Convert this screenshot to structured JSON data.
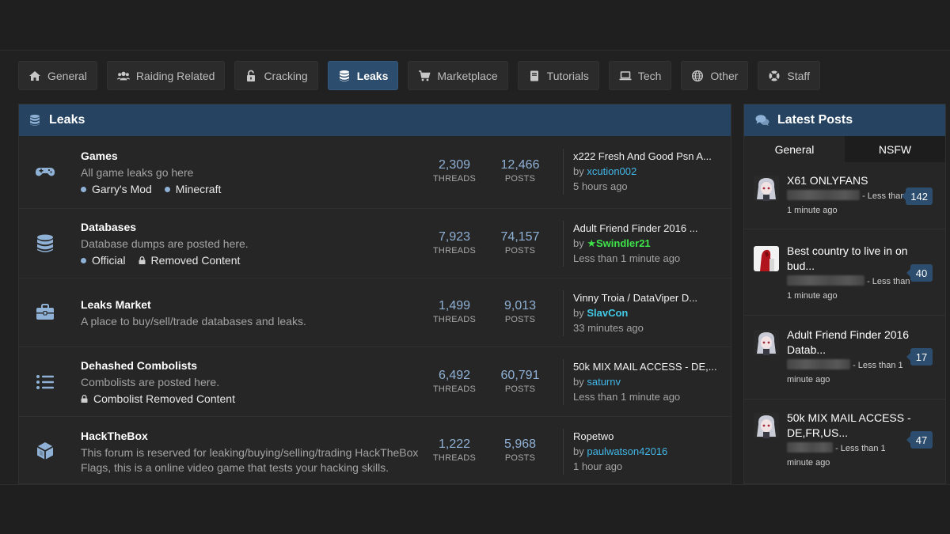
{
  "tabs": [
    {
      "label": "General",
      "icon": "home-icon"
    },
    {
      "label": "Raiding Related",
      "icon": "users-icon"
    },
    {
      "label": "Cracking",
      "icon": "unlock-icon"
    },
    {
      "label": "Leaks",
      "icon": "database-icon"
    },
    {
      "label": "Marketplace",
      "icon": "cart-icon"
    },
    {
      "label": "Tutorials",
      "icon": "book-icon"
    },
    {
      "label": "Tech",
      "icon": "laptop-icon"
    },
    {
      "label": "Other",
      "icon": "globe-icon"
    },
    {
      "label": "Staff",
      "icon": "lifering-icon"
    }
  ],
  "active_tab": "Leaks",
  "section": {
    "title": "Leaks",
    "forums": [
      {
        "icon": "gamepad-icon",
        "title": "Games",
        "desc": "All game leaks go here",
        "subs": [
          {
            "label": "Garry's Mod",
            "type": "dot"
          },
          {
            "label": "Minecraft",
            "type": "dot"
          }
        ],
        "threads": "2,309",
        "posts": "12,466",
        "threads_label": "THREADS",
        "posts_label": "POSTS",
        "last_title": "x222 Fresh And Good Psn A...",
        "by": "by",
        "last_user": "xcution002",
        "user_style": "normal",
        "last_time": "5 hours ago"
      },
      {
        "icon": "database-icon",
        "title": "Databases",
        "desc": "Database dumps are posted here.",
        "subs": [
          {
            "label": "Official",
            "type": "dot"
          },
          {
            "label": "Removed Content",
            "type": "lock"
          }
        ],
        "threads": "7,923",
        "posts": "74,157",
        "threads_label": "THREADS",
        "posts_label": "POSTS",
        "last_title": "Adult Friend Finder 2016 ...",
        "by": "by",
        "last_user": "Swindler21",
        "user_style": "green",
        "last_time": "Less than 1 minute ago"
      },
      {
        "icon": "briefcase-icon",
        "title": "Leaks Market",
        "desc": "A place to buy/sell/trade databases and leaks.",
        "subs": [],
        "threads": "1,499",
        "posts": "9,013",
        "threads_label": "THREADS",
        "posts_label": "POSTS",
        "last_title": "Vinny Troia / DataViper D...",
        "by": "by",
        "last_user": "SlavCon",
        "user_style": "cyan",
        "last_time": "33 minutes ago"
      },
      {
        "icon": "list-icon",
        "title": "Dehashed Combolists",
        "desc": "Combolists are posted here.",
        "subs": [
          {
            "label": "Combolist Removed Content",
            "type": "lock"
          }
        ],
        "threads": "6,492",
        "posts": "60,791",
        "threads_label": "THREADS",
        "posts_label": "POSTS",
        "last_title": "50k MIX MAIL ACCESS - DE,...",
        "by": "by",
        "last_user": "saturnv",
        "user_style": "normal",
        "last_time": "Less than 1 minute ago"
      },
      {
        "icon": "cube-icon",
        "title": "HackTheBox",
        "desc": "This forum is reserved for leaking/buying/selling/trading HackTheBox Flags, this is a online video game that tests your hacking skills.",
        "subs": [],
        "threads": "1,222",
        "posts": "5,968",
        "threads_label": "THREADS",
        "posts_label": "POSTS",
        "last_title": "Ropetwo",
        "by": "by",
        "last_user": "paulwatson42016",
        "user_style": "normal",
        "last_time": "1 hour ago"
      }
    ]
  },
  "latest": {
    "title": "Latest Posts",
    "tabs": [
      "General",
      "NSFW"
    ],
    "posts": [
      {
        "title": "X61 ONLYFANS",
        "meta_mid": "- Less than",
        "meta_end": "1 minute ago",
        "count": "142",
        "avatar": "anime-avatar"
      },
      {
        "title": "Best country to live in on bud...",
        "meta_mid": "- Less than",
        "meta_end": "1 minute ago",
        "count": "40",
        "avatar": "red-avatar"
      },
      {
        "title": "Adult Friend Finder 2016 Datab...",
        "meta_mid": "- Less than 1",
        "meta_end": "minute ago",
        "count": "17",
        "avatar": "anime-avatar"
      },
      {
        "title": "50k MIX MAIL ACCESS - DE,FR,US...",
        "meta_mid": "- Less than 1",
        "meta_end": "minute ago",
        "count": "47",
        "avatar": "anime-avatar"
      }
    ]
  },
  "colors": {
    "accent": "#264461",
    "stat": "#8fb1d6",
    "green_user": "#3ee34a",
    "cyan_user": "#41c9e6"
  }
}
